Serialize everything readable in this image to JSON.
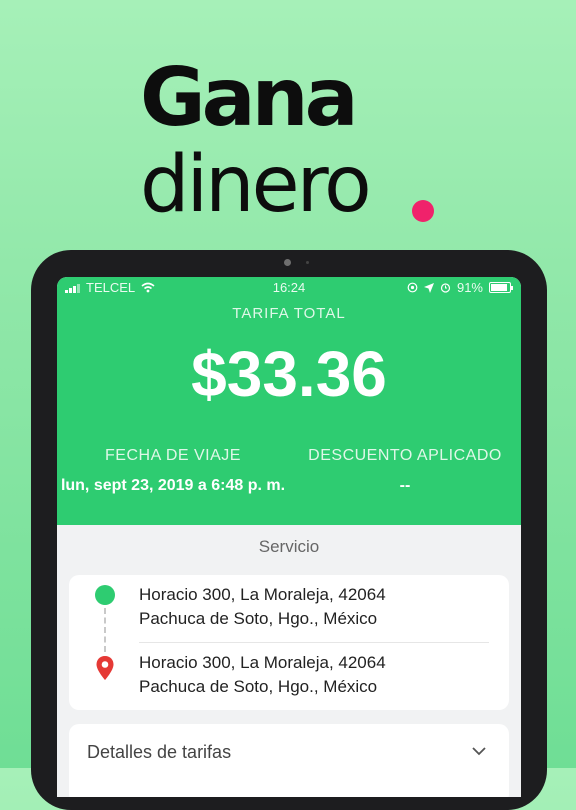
{
  "headline": {
    "line1": "Gana",
    "line2": "dinero"
  },
  "colors": {
    "accent_dot": "#f0226b",
    "green": "#2ecc71",
    "background": "#8fe7a8"
  },
  "status_bar": {
    "carrier": "TELCEL",
    "time": "16:24",
    "battery": "91%"
  },
  "fare": {
    "label": "TARIFA TOTAL",
    "amount": "$33.36",
    "date_label": "FECHA DE VIAJE",
    "date_value": "lun, sept 23, 2019 a 6:48 p. m.",
    "discount_label": "DESCUENTO APLICADO",
    "discount_value": "--"
  },
  "service_label": "Servicio",
  "route": {
    "origin": {
      "line1": "Horacio 300,  La Moraleja,  42064",
      "line2": "Pachuca de Soto,  Hgo.,  México"
    },
    "destination": {
      "line1": "Horacio 300,  La Moraleja,  42064",
      "line2": "Pachuca de Soto,  Hgo.,  México"
    }
  },
  "fee_details": {
    "label": "Detalles de tarifas",
    "icon": "chevron-down-icon"
  }
}
